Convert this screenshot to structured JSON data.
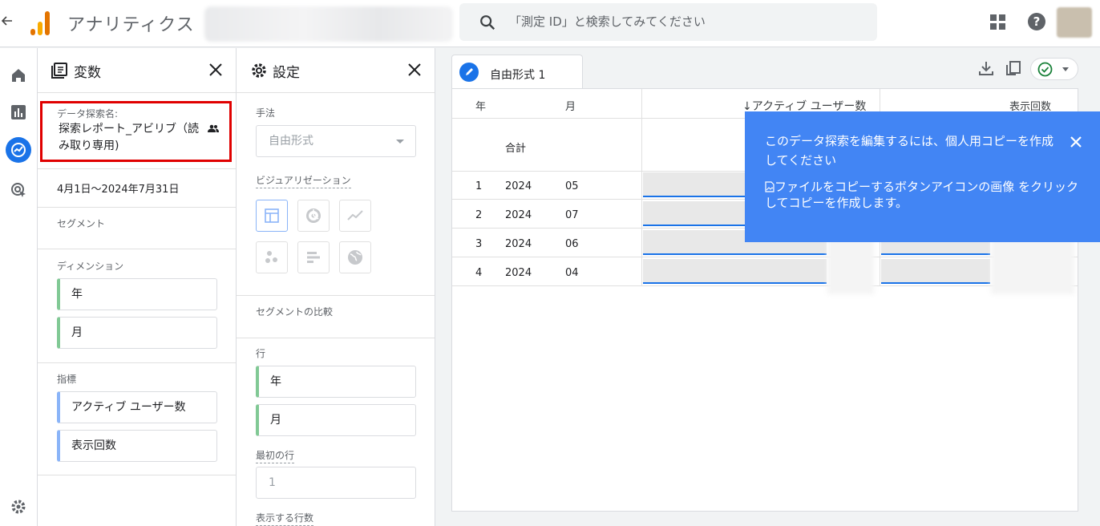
{
  "app": {
    "title": "アナリティクス",
    "back_icon": "back-arrow-icon"
  },
  "search": {
    "placeholder": "「測定 ID」と検索してみてください"
  },
  "colors": {
    "accent": "#1a73e8",
    "dimension": "#81c995",
    "metric": "#8ab4f8",
    "highlight": "#e00000",
    "tooltip": "#4285f4"
  },
  "variables": {
    "title": "変数",
    "exploration_name_label": "データ探索名:",
    "exploration_name_line1": "探索レポート_アビリブ（読",
    "exploration_name_line2": "み取り専用)",
    "date_range": "4月1日～2024年7月31日",
    "segments_label": "セグメント",
    "dimensions_label": "ディメンション",
    "dimensions": [
      "年",
      "月"
    ],
    "metrics_label": "指標",
    "metrics": [
      "アクティブ ユーザー数",
      "表示回数"
    ]
  },
  "settings": {
    "title": "設定",
    "technique_label": "手法",
    "technique_value": "自由形式",
    "visualization_label": "ビジュアリゼーション",
    "segment_comparison_label": "セグメントの比較",
    "rows_label": "行",
    "rows": [
      "年",
      "月"
    ],
    "first_row_label": "最初の行",
    "first_row_value": "1",
    "rows_to_show_label": "表示する行数"
  },
  "tab": {
    "label": "自由形式 1"
  },
  "table": {
    "headers": {
      "year": "年",
      "month": "月",
      "active_users": "↓アクティブ ユーザー数",
      "views": "表示回数"
    },
    "total_label": "合計",
    "rows": [
      {
        "index": "1",
        "year": "2024",
        "month": "05"
      },
      {
        "index": "2",
        "year": "2024",
        "month": "07"
      },
      {
        "index": "3",
        "year": "2024",
        "month": "06"
      },
      {
        "index": "4",
        "year": "2024",
        "month": "04"
      }
    ]
  },
  "tooltip": {
    "message": "このデータ探索を編集するには、個人用コピーを作成してください",
    "instruction": "ファイルをコピーするボタンアイコンの画像 をクリックしてコピーを作成します。"
  }
}
